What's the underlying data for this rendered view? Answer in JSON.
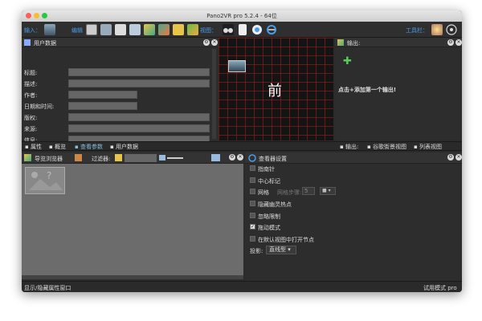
{
  "window": {
    "title": "Pano2VR pro 5.2.4 - 64位"
  },
  "toolbar": {
    "input_label": "输入：",
    "edit_label": "编辑",
    "view_label": "视图：",
    "tools_label": "工具栏："
  },
  "user_data": {
    "title": "用户数据",
    "fields": [
      {
        "label": "标题:"
      },
      {
        "label": "描述:"
      },
      {
        "label": "作者:"
      },
      {
        "label": "日期和时间:"
      },
      {
        "label": "版权:"
      },
      {
        "label": "来源:"
      },
      {
        "label": "信息:"
      }
    ]
  },
  "viewer": {
    "face_label": "前"
  },
  "output": {
    "title": "输出:",
    "hint": "点击+添加第一个输出!"
  },
  "left_tabs": [
    {
      "label": "属性"
    },
    {
      "label": "概览"
    },
    {
      "label": "查看参数"
    },
    {
      "label": "用户数据"
    }
  ],
  "right_tabs": [
    {
      "label": "输出:"
    },
    {
      "label": "谷歌街景视图"
    },
    {
      "label": "列表视图"
    }
  ],
  "browser": {
    "title": "导览浏览器",
    "filter_label": "过滤器:"
  },
  "viewer_settings": {
    "title": "查看器设置",
    "options": [
      {
        "label": "指南针",
        "checked": false
      },
      {
        "label": "中心标记",
        "checked": false
      },
      {
        "label": "网格",
        "checked": false
      },
      {
        "label": "隐藏幽灵热点",
        "checked": false
      },
      {
        "label": "忽略限制",
        "checked": false
      },
      {
        "label": "拖动模式",
        "checked": true
      },
      {
        "label": "在默认视图中打开节点",
        "checked": false
      }
    ],
    "grid_step_label": "网格步骤:",
    "grid_step_value": "5",
    "projection_label": "投影:",
    "projection_value": "直线型"
  },
  "status": {
    "left": "显示/隐藏属性窗口",
    "right": "试用模式 pro"
  }
}
